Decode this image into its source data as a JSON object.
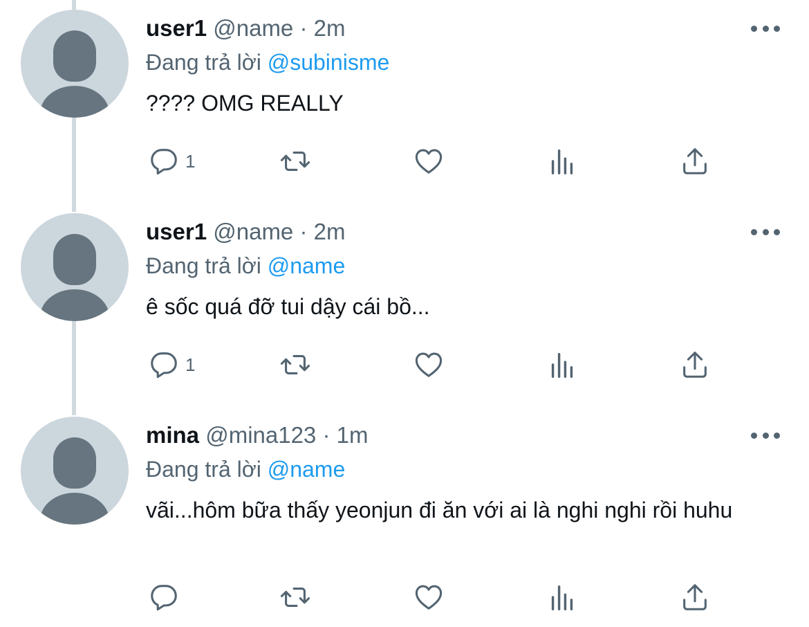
{
  "tweets": [
    {
      "name": "user1",
      "handle": "@name",
      "dot": "·",
      "time": "2m",
      "reply_prefix": "Đang trả lời",
      "reply_mention": "@subinisme",
      "text": "???? OMG REALLY",
      "reply_count": "1"
    },
    {
      "name": "user1",
      "handle": "@name",
      "dot": "·",
      "time": "2m",
      "reply_prefix": "Đang trả lời",
      "reply_mention": "@name",
      "text": "ê sốc quá đỡ tui dậy cái bồ...",
      "reply_count": "1"
    },
    {
      "name": "mina",
      "handle": "@mina123",
      "dot": "·",
      "time": "1m",
      "reply_prefix": "Đang trả lời",
      "reply_mention": "@name",
      "text": "vãi...hôm bữa thấy yeonjun đi ăn với ai là nghi nghi rồi huhu",
      "reply_count": ""
    }
  ],
  "icons": {
    "reply": "reply-icon",
    "retweet": "retweet-icon",
    "like": "heart-icon",
    "analytics": "analytics-icon",
    "share": "share-icon",
    "more": "more-icon"
  },
  "colors": {
    "text": "#0f1419",
    "secondary": "#536471",
    "link": "#1d9bf0",
    "avatar_bg": "#ccd6dd",
    "avatar_fg": "#66757f",
    "thread_line": "#cfd9de"
  }
}
